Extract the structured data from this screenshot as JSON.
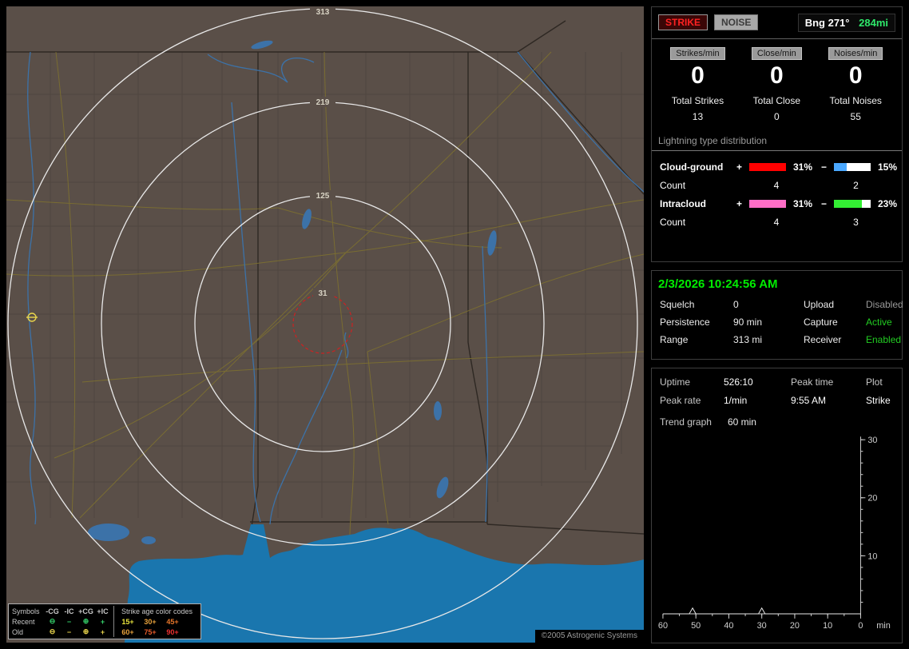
{
  "map": {
    "ring_labels": [
      "313",
      "219",
      "125",
      "31"
    ],
    "copyright": "©2005 Astrogenic Systems",
    "legend": {
      "col_headers": [
        "Symbols",
        "-CG",
        "-IC",
        "+CG",
        "+IC"
      ],
      "age_header": "Strike age color codes",
      "rows": [
        {
          "label": "Recent",
          "symbols": [
            "⊖",
            "−",
            "⊕",
            "+"
          ],
          "symbol_color": "#35d06a",
          "ages": [
            {
              "text": "15+",
              "color": "#e8e23c"
            },
            {
              "text": "30+",
              "color": "#e8a23c"
            },
            {
              "text": "45+",
              "color": "#e8762a"
            }
          ]
        },
        {
          "label": "Old",
          "symbols": [
            "⊖",
            "−",
            "⊕",
            "+"
          ],
          "symbol_color": "#e8d44c",
          "ages": [
            {
              "text": "60+",
              "color": "#e8a23c"
            },
            {
              "text": "75+",
              "color": "#e85c2a"
            },
            {
              "text": "90+",
              "color": "#ee3030"
            }
          ]
        }
      ]
    }
  },
  "panel": {
    "strike_button": "STRIKE",
    "noise_button": "NOISE",
    "bearing_label": "Bng 271°",
    "bearing_range": "284mi",
    "counters": [
      {
        "label": "Strikes/min",
        "value": "0",
        "total_label": "Total Strikes",
        "total": "13"
      },
      {
        "label": "Close/min",
        "value": "0",
        "total_label": "Total Close",
        "total": "0"
      },
      {
        "label": "Noises/min",
        "value": "0",
        "total_label": "Total Noises",
        "total": "55"
      }
    ],
    "distribution": {
      "title": "Lightning type distribution",
      "plus_sign": "+",
      "minus_sign": "−",
      "rows": [
        {
          "label": "Cloud-ground",
          "plus_pct": "31%",
          "minus_pct": "15%",
          "plus_color": "#ff0000",
          "minus_color": "#4aa8ff",
          "plus_fill": 100,
          "minus_fill": 35,
          "count_label": "Count",
          "plus_count": "4",
          "minus_count": "2"
        },
        {
          "label": "Intracloud",
          "plus_pct": "31%",
          "minus_pct": "23%",
          "plus_color": "#ff6ec7",
          "minus_color": "#33ee33",
          "plus_fill": 100,
          "minus_fill": 75,
          "count_label": "Count",
          "plus_count": "4",
          "minus_count": "3"
        }
      ]
    },
    "datetime": "2/3/2026 10:24:56 AM",
    "settings": [
      {
        "label": "Squelch",
        "value": "0",
        "label2": "Upload",
        "value2": "Disabled",
        "value2_color": "#9a9a9a"
      },
      {
        "label": "Persistence",
        "value": "90 min",
        "label2": "Capture",
        "value2": "Active",
        "value2_color": "#22cc22"
      },
      {
        "label": "Range",
        "value": "313 mi",
        "label2": "Receiver",
        "value2": "Enabled",
        "value2_color": "#22cc22"
      }
    ],
    "stats": {
      "r1": [
        "Uptime",
        "526:10",
        "Peak time",
        "Plot"
      ],
      "r2": [
        "Peak rate",
        "1/min",
        "9:55 AM",
        "Strike"
      ],
      "trend_label": "Trend graph",
      "trend_value": "60 min"
    }
  },
  "chart_data": {
    "type": "line",
    "title": "Trend graph",
    "window": "60 min",
    "x_ticks": [
      60,
      50,
      40,
      30,
      20,
      10,
      0
    ],
    "x_unit": "min",
    "x_minor_step": 5,
    "y_ticks": [
      10,
      20,
      30
    ],
    "y_minor_step": 2,
    "ylim": [
      0,
      30
    ],
    "series": [
      {
        "name": "Strike",
        "minutes_ago_start": 60,
        "values": [
          0,
          0,
          0,
          0,
          0,
          0,
          0,
          0,
          0,
          1,
          0,
          0,
          0,
          0,
          0,
          0,
          0,
          0,
          0,
          0,
          0,
          0,
          0,
          0,
          0,
          0,
          0,
          0,
          0,
          0,
          1,
          0,
          0,
          0,
          0,
          0,
          0,
          0,
          0,
          0,
          0,
          0,
          0,
          0,
          0,
          0,
          0,
          0,
          0,
          0,
          0,
          0,
          0,
          0,
          0,
          0,
          0,
          0,
          0,
          0,
          0
        ]
      }
    ]
  }
}
